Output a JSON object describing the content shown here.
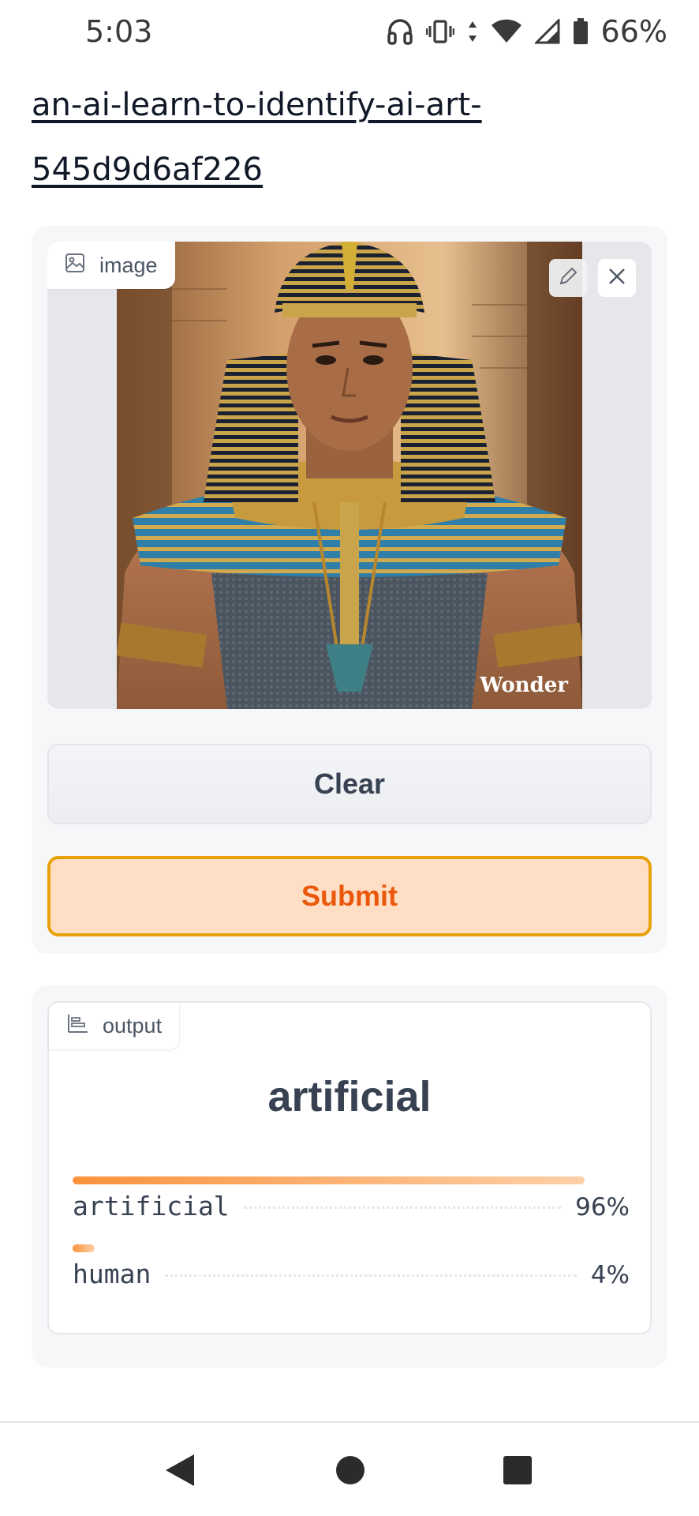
{
  "status_bar": {
    "time": "5:03",
    "battery_percent": "66%",
    "icons": [
      "headphones-icon",
      "vibrate-icon",
      "data-arrows-icon",
      "wifi-icon",
      "cell-signal-icon",
      "battery-icon"
    ]
  },
  "page": {
    "title_link": "an-ai-learn-to-identify-ai-art-545d9d6af226"
  },
  "input": {
    "label": "image",
    "image_watermark": "Wonder",
    "clear_label": "Clear",
    "submit_label": "Submit"
  },
  "output": {
    "label": "output",
    "predicted": "artificial",
    "confidences": [
      {
        "label": "artificial",
        "value": "96%",
        "fraction": 0.96
      },
      {
        "label": "human",
        "value": "4%",
        "fraction": 0.04
      }
    ]
  },
  "colors": {
    "submit_border": "#e8a10b",
    "submit_bg": "#fedfc5",
    "submit_text": "#ea580c",
    "bar_start": "#fb923c",
    "bar_end": "#fdd0a8"
  }
}
